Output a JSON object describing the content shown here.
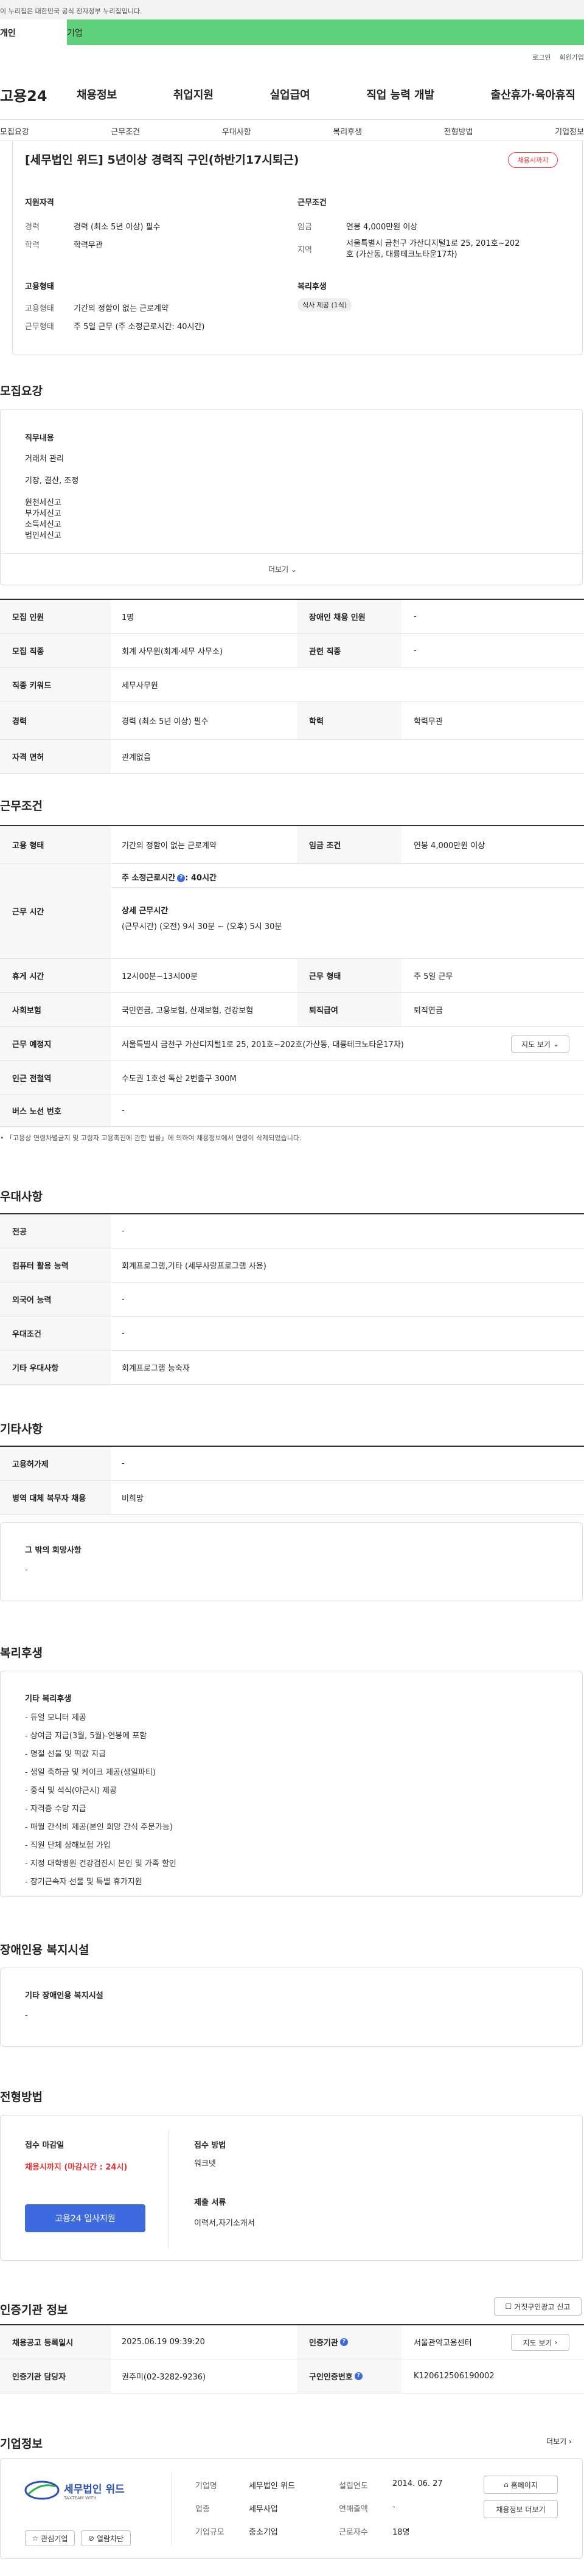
{
  "gov_notice": "이 누리집은 대한민국 공식 전자정부 누리집입니다.",
  "member_tabs": {
    "person": "개인",
    "corp": "기업"
  },
  "util": {
    "login": "로그인",
    "join": "회원가입"
  },
  "gnb": {
    "logo": "고용24",
    "items": [
      "채용정보",
      "취업지원",
      "실업급여",
      "직업 능력 개발",
      "출산휴가·육아휴직"
    ]
  },
  "lnb": [
    "모집요강",
    "근무조건",
    "우대사항",
    "복리후생",
    "전형방법",
    "기업정보"
  ],
  "header": {
    "title": "[세무법인 위드] 5년이상 경력직 구인(하반기17시퇴근)",
    "badge": "채용시까지",
    "qual_title": "지원자격",
    "qual": [
      {
        "k": "경력",
        "v": "경력 (최소 5년 이상) 필수"
      },
      {
        "k": "학력",
        "v": "학력무관"
      }
    ],
    "cond_title": "근무조건",
    "cond": [
      {
        "k": "임금",
        "v": "연봉 4,000만원 이상"
      },
      {
        "k": "지역",
        "v": "서울특별시 금천구 가산디지털1로 25, 201호~202호 (가산동, 대륭테크노타운17차)"
      }
    ],
    "emp_title": "고용형태",
    "emp": [
      {
        "k": "고용형태",
        "v": "기간의 정함이 없는 근로계약"
      },
      {
        "k": "근무형태",
        "v": "주 5일 근무 (주 소정근로시간: 40시간)"
      }
    ],
    "welfare_title": "복리후생",
    "welfare_chip": "식사 제공 (1식)"
  },
  "recruit": {
    "title": "모집요강",
    "duty_title": "직무내용",
    "duties": [
      "거래처 관리",
      "기장, 결산, 조정",
      "원천세신고",
      "부가세신고",
      "소득세신고",
      "법인세신고"
    ],
    "more": "더보기",
    "rows": [
      {
        "k1": "모집 인원",
        "v1": "1명",
        "k2": "장애인 채용 인원",
        "v2": "-"
      },
      {
        "k1": "모집 직종",
        "v1": "회계 사무원(회계·세무 사무소)",
        "k2": "관련 직종",
        "v2": "-"
      },
      {
        "k1": "직종 키워드",
        "v1": "세무사무원",
        "k2": "",
        "v2": ""
      },
      {
        "k1": "경력",
        "v1": "경력 (최소 5년 이상) 필수",
        "k2": "학력",
        "v2": "학력무관"
      },
      {
        "k1": "자격 면허",
        "v1": "관계없음",
        "k2": "",
        "v2": ""
      }
    ]
  },
  "work": {
    "title": "근무조건",
    "emp_k": "고용 형태",
    "emp_v": "기간의 정함이 없는 근로계약",
    "wage_k": "임금 조건",
    "wage_v": "연봉 4,000만원 이상",
    "time_k": "근무 시간",
    "time_week": "주 소정근로시간",
    "time_week_v": ": 40시간",
    "time_detail_title": "상세 근무시간",
    "time_detail": "(근무시간) (오전) 9시 30분 ~ (오후) 5시 30분",
    "break_k": "휴게 시간",
    "break_v": "12시00분~13시00분",
    "shift_k": "근무 형태",
    "shift_v": "주 5일 근무",
    "ins_k": "사회보험",
    "ins_v": "국민연금, 고용보험, 산재보험, 건강보험",
    "sev_k": "퇴직급여",
    "sev_v": "퇴직연금",
    "place_k": "근무 예정지",
    "place_v": "서울특별시 금천구 가산디지털1로 25, 201호~202호(가산동, 대륭테크노타운17차)",
    "map_btn": "지도 보기",
    "subway_k": "인근 전철역",
    "subway_v": "수도권 1호선 독산 2번출구 300M",
    "bus_k": "버스 노선 번호",
    "bus_v": "-",
    "note": "「고용상 연령차별금지 및 고령자 고용촉진에 관한 법률」에 의하여 채용정보에서 연령이 삭제되었습니다."
  },
  "pref": {
    "title": "우대사항",
    "rows": [
      {
        "k": "전공",
        "v": "-"
      },
      {
        "k": "컴퓨터 활용 능력",
        "v": "회계프로그램,기타 (세무사랑프로그램 사용)"
      },
      {
        "k": "외국어 능력",
        "v": "-"
      },
      {
        "k": "우대조건",
        "v": "-"
      },
      {
        "k": "기타 우대사항",
        "v": "회계프로그램 능숙자"
      }
    ]
  },
  "etc": {
    "title": "기타사항",
    "rows": [
      {
        "k": "고용허가제",
        "v": "-"
      },
      {
        "k": "병역 대체 복무자 채용",
        "v": "비희망"
      }
    ],
    "wish_title": "그 밖의 희망사항",
    "wish_v": "-"
  },
  "welfare": {
    "title": "복리후생",
    "sub": "기타 복리후생",
    "items": [
      "- 듀얼 모니터 제공",
      "- 상여금 지급(3월, 5월)-연봉에 포함",
      "- 명절 선물 및 떡값 지급",
      "- 생일 축하금 및 케이크 제공(생일파티)",
      "- 중식 및 석식(야근시) 제공",
      "- 자격증 수당 지급",
      "- 매월 간식비 제공(본인 희망 간식 주문가능)",
      "- 직원 단체 상해보험 가입",
      "- 지정 대학병원 건강검진시 본인 및 가족 할인",
      "- 장기근속자 선물 및 특별 휴가지원"
    ]
  },
  "disabled": {
    "title": "장애인용 복지시설",
    "sub": "기타 장애인용 복지시설",
    "v": "-"
  },
  "apply": {
    "title": "전형방법",
    "deadline_k": "접수 마감일",
    "deadline_v": "채용시까지 (마감시간 : 24시)",
    "btn": "고용24 입사지원",
    "method_k": "접수 방법",
    "method_v": "워크넷",
    "docs_k": "제출 서류",
    "docs_v": "이력서,자기소개서"
  },
  "agency": {
    "title": "인증기관 정보",
    "report_btn": "거짓구인광고 신고",
    "reg_k": "채용공고 등록일시",
    "reg_v": "2025.06.19 09:39:20",
    "org_k": "인증기관",
    "org_v": "서울관악고용센터",
    "map_btn": "지도 보기",
    "manager_k": "인증기관 담당자",
    "manager_v": "권주미(02-3282-9236)",
    "no_k": "구인인증번호",
    "no_v": "K120612506190002"
  },
  "company": {
    "title": "기업정보",
    "more": "더보기",
    "logo_text": "세무법인 위드",
    "logo_sub": "TAXTEAM WITH",
    "fields": [
      {
        "k": "기업명",
        "v": "세무법인 위드"
      },
      {
        "k": "업종",
        "v": "세무사업"
      },
      {
        "k": "기업규모",
        "v": "중소기업"
      },
      {
        "k": "설립연도",
        "v": "2014. 06. 27"
      },
      {
        "k": "연매출액",
        "v": "-"
      },
      {
        "k": "근로자수",
        "v": "18명"
      }
    ],
    "fav_btn": "관심기업",
    "block_btn": "열람차단",
    "home_btn": "홈페이지",
    "list_btn": "채용정보 더보기"
  },
  "colors": {
    "accent": "#3e6ae0",
    "tab_green": "#5fd07c",
    "deadline_red": "#e33333"
  }
}
